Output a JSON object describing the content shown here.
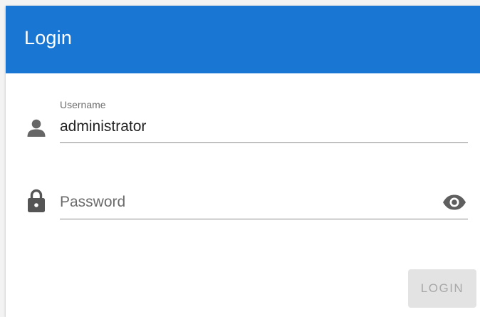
{
  "dialog": {
    "title": "Login"
  },
  "username_field": {
    "label": "Username",
    "value": "administrator",
    "icon": "person-icon"
  },
  "password_field": {
    "placeholder": "Password",
    "value": "",
    "icon": "lock-icon",
    "visibility_icon": "eye-icon"
  },
  "actions": {
    "login_label": "LOGIN",
    "login_disabled": true
  },
  "colors": {
    "header": "#1976d2",
    "header_text": "#ffffff",
    "button_disabled_bg": "#e3e3e3",
    "button_disabled_text": "#a8a8a8"
  }
}
